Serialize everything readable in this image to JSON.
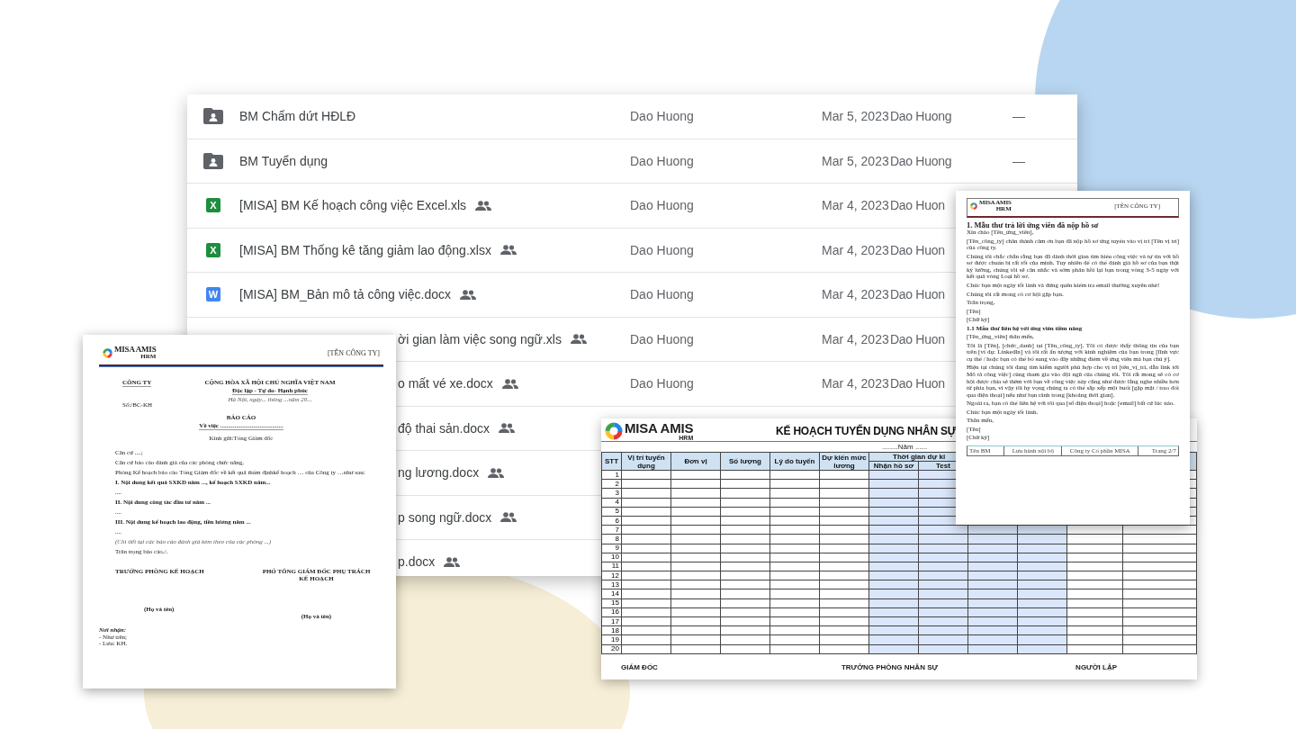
{
  "file_list": {
    "rows": [
      {
        "kind": "folder",
        "name": "BM Chấm dứt HĐLĐ",
        "shared": false,
        "owner": "Dao Huong",
        "date": "Mar 5, 2023",
        "modified_by": "Dao Huong",
        "size": "—"
      },
      {
        "kind": "folder",
        "name": "BM Tuyển dụng",
        "shared": false,
        "owner": "Dao Huong",
        "date": "Mar 5, 2023",
        "modified_by": "Dao Huong",
        "size": "—"
      },
      {
        "kind": "sheet",
        "badge": "X",
        "name": "[MISA] BM Kế hoạch công việc Excel.xls",
        "shared": true,
        "owner": "Dao Huong",
        "date": "Mar 4, 2023",
        "modified_by": "Dao Huon"
      },
      {
        "kind": "sheet",
        "badge": "X",
        "name": "[MISA] BM Thống kê tăng giảm lao động.xlsx",
        "shared": true,
        "owner": "Dao Huong",
        "date": "Mar 4, 2023",
        "modified_by": "Dao Huon"
      },
      {
        "kind": "doc",
        "badge": "W",
        "name": "[MISA] BM_Bản mô tả công việc.docx",
        "shared": true,
        "owner": "Dao Huong",
        "date": "Mar 4, 2023",
        "modified_by": "Dao Huon"
      },
      {
        "kind": "hidden",
        "name": "ời gian làm việc song ngữ.xls",
        "shared": true,
        "owner": "Dao Huong",
        "date": "Mar 4, 2023",
        "modified_by": "Dao Huon"
      },
      {
        "kind": "hidden",
        "name": "o mất vé xe.docx",
        "shared": true,
        "owner": "Dao Huong",
        "date": "Mar 4, 2023",
        "modified_by": "Dao Huon"
      },
      {
        "kind": "hidden",
        "name": "độ thai sản.docx",
        "shared": true
      },
      {
        "kind": "hidden",
        "name": "ng lương.docx",
        "shared": true
      },
      {
        "kind": "hidden",
        "name": "p song ngữ.docx",
        "shared": true
      },
      {
        "kind": "hidden",
        "name": "p.docx",
        "shared": true
      }
    ]
  },
  "report_doc": {
    "logo": {
      "name": "MISA AMIS",
      "sub": "HRM"
    },
    "company_tag": "[TÊN CÔNG TY]",
    "org": "CÔNG TY",
    "number": "Số:/BC-KH",
    "republic": "CỘNG HÒA XÃ HỘI CHỦ NGHĨA VIỆT NAM",
    "motto": "Độc lập - Tự do- Hạnh phúc",
    "place_date": "Hà Nội, ngày... thủng ...năm 20...",
    "title": "BÁO CÁO",
    "subject": "Về việc ........................................",
    "addressee": "Kính gửi:Tổng Giám đốc",
    "body": [
      {
        "kind": "plain",
        "text": "Căn cứ ....;"
      },
      {
        "kind": "plain",
        "text": "Căn cứ báo cáo đánh giá của các phòng chức năng,"
      },
      {
        "kind": "plain",
        "text": "Phòng Kế hoạch báo cáo Tổng Giám đốc về kết quả thẩm địnhkế hoạch … của Công ty …như sau:"
      },
      {
        "kind": "heading",
        "text": "I. Nội dung kết quả SXKD năm ..., kế hoạch SXKD năm..."
      },
      {
        "kind": "plain",
        "text": "...."
      },
      {
        "kind": "heading",
        "text": "II. Nội dung công tác đầu tư năm ..."
      },
      {
        "kind": "plain",
        "text": "...."
      },
      {
        "kind": "heading",
        "text": "III. Nội dung kế hoạch lao động, tiền lương năm ..."
      },
      {
        "kind": "plain",
        "text": "...."
      },
      {
        "kind": "note",
        "text": "(Chi tiết tại các báo cáo đánh giá kèm theo của các phòng ...)"
      },
      {
        "kind": "plain",
        "text": "Trân trọng báo cáo./."
      }
    ],
    "signers": [
      {
        "title": "TRƯỞNG PHÒNG KẾ HOẠCH",
        "name": "(Họ và tên)"
      },
      {
        "title": "PHÓ TỔNG GIÁM ĐỐC PHỤ TRÁCH KẾ HOẠCH",
        "name": "(Họ và tên)"
      }
    ],
    "recipients_label": "Nơi nhận:",
    "recipients": [
      "- Như trên;",
      "- Lưu: KH."
    ]
  },
  "plan_sheet": {
    "logo": {
      "name": "MISA AMIS",
      "sub": "HRM"
    },
    "title": "KẾ HOẠCH TUYỂN DỤNG NHÂN SỰ",
    "year": "........Năm ......",
    "columns": [
      "STT",
      "Vị trí tuyển dụng",
      "Đơn vị",
      "Số lượng",
      "Lý do tuyển",
      "Dự kiến mức lương"
    ],
    "group": "Thời gian dự ki",
    "subcolumns": [
      "Nhận hồ sơ",
      "Test"
    ],
    "rows": [
      "1",
      "2",
      "3",
      "4",
      "5",
      "6",
      "7",
      "8",
      "9",
      "10",
      "11",
      "12",
      "13",
      "14",
      "15",
      "16",
      "17",
      "18",
      "19",
      "20"
    ],
    "signers": [
      "GIÁM ĐỐC",
      "TRƯỞNG PHÒNG NHÂN SỰ",
      "NGƯỜI LẬP"
    ]
  },
  "letter_doc": {
    "logo": {
      "name": "MISA AMIS",
      "sub": "HRM"
    },
    "company_tag": "[TÊN CÔNG TY]",
    "blocks": [
      {
        "kind": "h1",
        "text": "1. Mẫu thư trả lời ứng viên đã nộp hồ sơ"
      },
      {
        "kind": "tight",
        "text": "Xin chào [Tên_ứng_viên],"
      },
      {
        "kind": "p",
        "text": "[Tên_công_ty] chân thành cảm ơn bạn đã nộp hồ sơ ứng tuyển vào vị trí [Tên vị trí] của công ty."
      },
      {
        "kind": "p",
        "text": "Chúng tôi chắc chắn rằng bạn đã dành thời gian tìm hiểu công việc và tự tin với hồ sơ được chuẩn bị rất tốt của mình. Tuy nhiên để có thể đánh giá hồ sơ của bạn thật kỹ lưỡng, chúng tôi sẽ cân nhắc và sớm phản hồi lại bạn trong vòng 3-5 ngày với kết quả vòng Loại hồ sơ."
      },
      {
        "kind": "p",
        "text": "Chúc bạn một ngày tốt lành và đừng quên kiểm tra email thường xuyên nhé!"
      },
      {
        "kind": "p",
        "text": "Chúng tôi rất mong có cơ hội gặp bạn."
      },
      {
        "kind": "p",
        "text": "Trân trọng,"
      },
      {
        "kind": "p",
        "text": "[Tên]"
      },
      {
        "kind": "p",
        "text": "[Chữ ký]"
      },
      {
        "kind": "h2",
        "text": "1.1 Mẫu thư liên hệ với ứng viên tiềm năng"
      },
      {
        "kind": "p",
        "text": "[Tên_ứng_viên] thân mến,"
      },
      {
        "kind": "p",
        "text": "Tôi là [Tên], [chức_danh] tại [Tên_công_ty]. Tôi có được thấy thông tin của bạn trên [ví dụ: LinkedIn] và tôi rất ấn tượng với kinh nghiệm của bạn trong [lĩnh vực cụ thể / hoặc bạn có thể bổ sung vào đây những điểm về ứng viên mà bạn chú ý]."
      },
      {
        "kind": "p",
        "text": "Hiện tại chúng tôi đang tìm kiếm người phù hợp cho vị trí [tên_vị_trí, dẫn link tới Mô tả công việc] cùng tham gia vào đội ngũ của chúng tôi. Tôi rất mong sẽ có cơ hội được chia sẻ thêm với bạn về công việc này cũng như được lắng nghe nhiều hơn từ phía bạn, vì vậy tôi hy vọng chúng ta có thể sắp xếp một buổi [gặp mặt / trao đổi qua điện thoại] nếu như bạn rảnh trong [khoảng thời gian]."
      },
      {
        "kind": "p",
        "text": "Ngoài ra, bạn có thể liên hệ với tôi qua [số điện thoại] hoặc [email] bất cứ lúc nào."
      },
      {
        "kind": "p",
        "text": "Chúc bạn một ngày tốt lành."
      },
      {
        "kind": "p",
        "text": "Thân mến,"
      },
      {
        "kind": "p",
        "text": "[Tên]"
      },
      {
        "kind": "p",
        "text": "[Chữ ký]"
      }
    ],
    "footer": [
      "Tên BM",
      "Lưu hành nội bộ",
      "Công ty Cổ phần MISA",
      "Trang 2/7"
    ]
  }
}
